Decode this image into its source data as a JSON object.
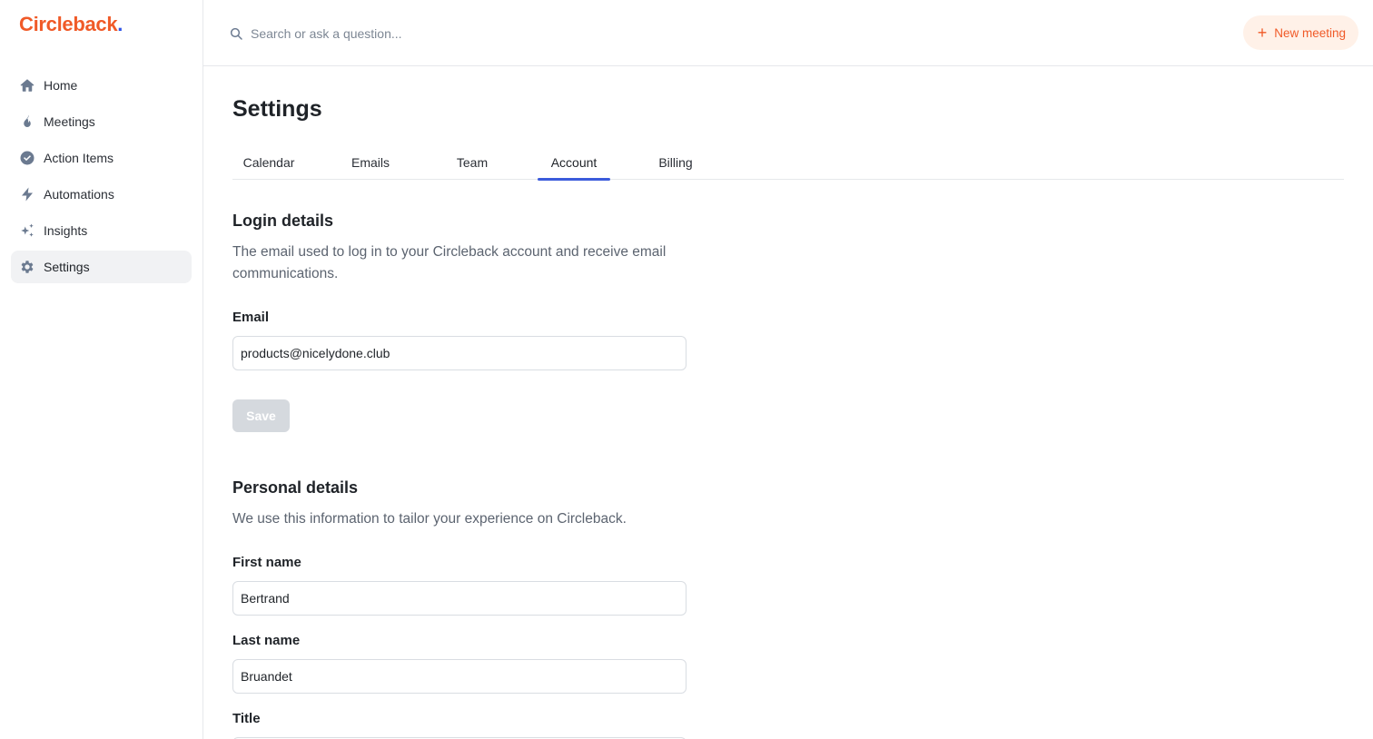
{
  "brand": {
    "name": "Circleback",
    "dot": "."
  },
  "sidebar": {
    "items": [
      {
        "label": "Home",
        "icon": "home-icon",
        "active": false
      },
      {
        "label": "Meetings",
        "icon": "flame-icon",
        "active": false
      },
      {
        "label": "Action Items",
        "icon": "check-circle-icon",
        "active": false
      },
      {
        "label": "Automations",
        "icon": "lightning-icon",
        "active": false
      },
      {
        "label": "Insights",
        "icon": "sparkles-icon",
        "active": false
      },
      {
        "label": "Settings",
        "icon": "gear-icon",
        "active": true
      }
    ]
  },
  "topbar": {
    "search_placeholder": "Search or ask a question...",
    "new_meeting_label": "New meeting"
  },
  "page": {
    "title": "Settings",
    "tabs": [
      {
        "label": "Calendar",
        "active": false
      },
      {
        "label": "Emails",
        "active": false
      },
      {
        "label": "Team",
        "active": false
      },
      {
        "label": "Account",
        "active": true
      },
      {
        "label": "Billing",
        "active": false
      }
    ]
  },
  "login": {
    "title": "Login details",
    "description": "The email used to log in to your Circleback account and receive email communications.",
    "email_label": "Email",
    "email_value": "products@nicelydone.club",
    "save_label": "Save"
  },
  "personal": {
    "title": "Personal details",
    "description": "We use this information to tailor your experience on Circleback.",
    "first_name_label": "First name",
    "first_name_value": "Bertrand",
    "last_name_label": "Last name",
    "last_name_value": "Bruandet",
    "title_label": "Title"
  },
  "colors": {
    "brand_orange": "#f05a28",
    "accent_blue": "#3b5bdb",
    "icon_gray": "#6b7a90"
  }
}
